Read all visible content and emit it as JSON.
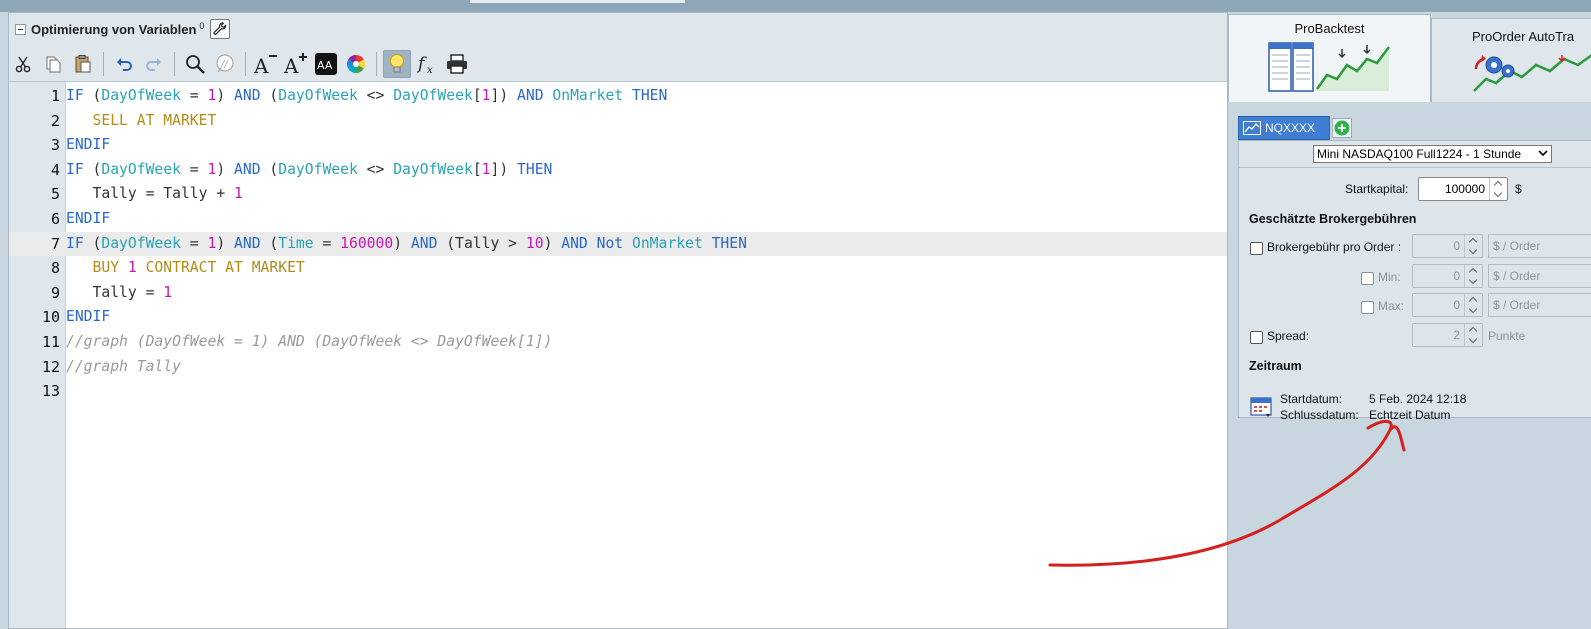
{
  "editor": {
    "title": "Optimierung von Variablen",
    "title_superscript": "0",
    "toolbar_icons": [
      "cut-icon",
      "copy-icon",
      "paste-icon",
      "undo-icon",
      "redo-icon",
      "search-icon",
      "comment-icon",
      "font-decrease-icon",
      "font-increase-icon",
      "font-style-icon",
      "color-wheel-icon",
      "lightbulb-icon",
      "function-icon",
      "print-icon"
    ],
    "lines": [
      {
        "num": "1",
        "tokens": [
          [
            "k",
            "IF"
          ],
          [
            "t",
            " ("
          ],
          [
            "f",
            "DayOfWeek"
          ],
          [
            "t",
            " = "
          ],
          [
            "n",
            "1"
          ],
          [
            "t",
            ") "
          ],
          [
            "k",
            "AND"
          ],
          [
            "t",
            " ("
          ],
          [
            "f",
            "DayOfWeek"
          ],
          [
            "t",
            " <> "
          ],
          [
            "f",
            "DayOfWeek"
          ],
          [
            "t",
            "["
          ],
          [
            "n",
            "1"
          ],
          [
            "t",
            "]) "
          ],
          [
            "k",
            "AND"
          ],
          [
            "t",
            " "
          ],
          [
            "f",
            "OnMarket"
          ],
          [
            "t",
            " "
          ],
          [
            "k",
            "THEN"
          ]
        ]
      },
      {
        "num": "2",
        "tokens": [
          [
            "t",
            "   "
          ],
          [
            "o",
            "SELL AT MARKET"
          ]
        ]
      },
      {
        "num": "3",
        "tokens": [
          [
            "k",
            "ENDIF"
          ]
        ]
      },
      {
        "num": "4",
        "tokens": [
          [
            "k",
            "IF"
          ],
          [
            "t",
            " ("
          ],
          [
            "f",
            "DayOfWeek"
          ],
          [
            "t",
            " = "
          ],
          [
            "n",
            "1"
          ],
          [
            "t",
            ") "
          ],
          [
            "k",
            "AND"
          ],
          [
            "t",
            " ("
          ],
          [
            "f",
            "DayOfWeek"
          ],
          [
            "t",
            " <> "
          ],
          [
            "f",
            "DayOfWeek"
          ],
          [
            "t",
            "["
          ],
          [
            "n",
            "1"
          ],
          [
            "t",
            "]) "
          ],
          [
            "k",
            "THEN"
          ]
        ]
      },
      {
        "num": "5",
        "tokens": [
          [
            "t",
            "   Tally = Tally + "
          ],
          [
            "n",
            "1"
          ]
        ]
      },
      {
        "num": "6",
        "tokens": [
          [
            "k",
            "ENDIF"
          ]
        ]
      },
      {
        "num": "7",
        "tokens": [
          [
            "k",
            "IF"
          ],
          [
            "t",
            " ("
          ],
          [
            "f",
            "DayOfWeek"
          ],
          [
            "t",
            " = "
          ],
          [
            "n",
            "1"
          ],
          [
            "t",
            ") "
          ],
          [
            "k",
            "AND"
          ],
          [
            "t",
            " ("
          ],
          [
            "f",
            "Time"
          ],
          [
            "t",
            " = "
          ],
          [
            "n",
            "160000"
          ],
          [
            "t",
            ") "
          ],
          [
            "k",
            "AND"
          ],
          [
            "t",
            " (Tally > "
          ],
          [
            "n",
            "10"
          ],
          [
            "t",
            ") "
          ],
          [
            "k",
            "AND"
          ],
          [
            "t",
            " "
          ],
          [
            "k",
            "Not"
          ],
          [
            "t",
            " "
          ],
          [
            "f",
            "OnMarket"
          ],
          [
            "t",
            " "
          ],
          [
            "k",
            "THEN"
          ]
        ]
      },
      {
        "num": "8",
        "tokens": [
          [
            "t",
            "   "
          ],
          [
            "o",
            "BUY "
          ],
          [
            "n",
            "1"
          ],
          [
            "o",
            " CONTRACT AT MARKET"
          ]
        ]
      },
      {
        "num": "9",
        "tokens": [
          [
            "t",
            "   Tally = "
          ],
          [
            "n",
            "1"
          ]
        ]
      },
      {
        "num": "10",
        "tokens": [
          [
            "k",
            "ENDIF"
          ]
        ]
      },
      {
        "num": "11",
        "tokens": [
          [
            "c",
            "//graph (DayOfWeek = 1) AND (DayOfWeek <> DayOfWeek[1])"
          ]
        ]
      },
      {
        "num": "12",
        "tokens": [
          [
            "c",
            "//graph Tally"
          ]
        ]
      },
      {
        "num": "13",
        "tokens": []
      }
    ],
    "highlighted_line": 7
  },
  "right_panel": {
    "tab_probacktest": "ProBacktest",
    "tab_proorder": "ProOrder AutoTra",
    "instrument_tab": "NQXXXX",
    "instrument_select": "Mini NASDAQ100 Full1224 - 1 Stunde",
    "startkapital_label": "Startkapital:",
    "startkapital_value": "100000",
    "currency": "$",
    "broker_heading": "Geschätzte Brokergebühren",
    "broker_order_label": "Brokergebühr pro Order :",
    "broker_order_value": "0",
    "broker_order_unit": "$ / Order",
    "min_label": "Min:",
    "min_value": "0",
    "min_unit": "$ / Order",
    "max_label": "Max:",
    "max_value": "0",
    "max_unit": "$ / Order",
    "spread_label": "Spread:",
    "spread_value": "2",
    "spread_unit": "Punkte",
    "zeitraum_heading": "Zeitraum",
    "startdatum_label": "Startdatum:",
    "startdatum_value": "5 Feb. 2024 12:18",
    "schlussdatum_label": "Schlussdatum:",
    "schlussdatum_value": "Echtzeit Datum"
  },
  "colors": {
    "keyword": "#2b69c8",
    "function": "#2aa3b5",
    "number": "#c21ab5",
    "order": "#b38d1a",
    "comment": "#9a9a9a",
    "annotation": "#d42020"
  }
}
